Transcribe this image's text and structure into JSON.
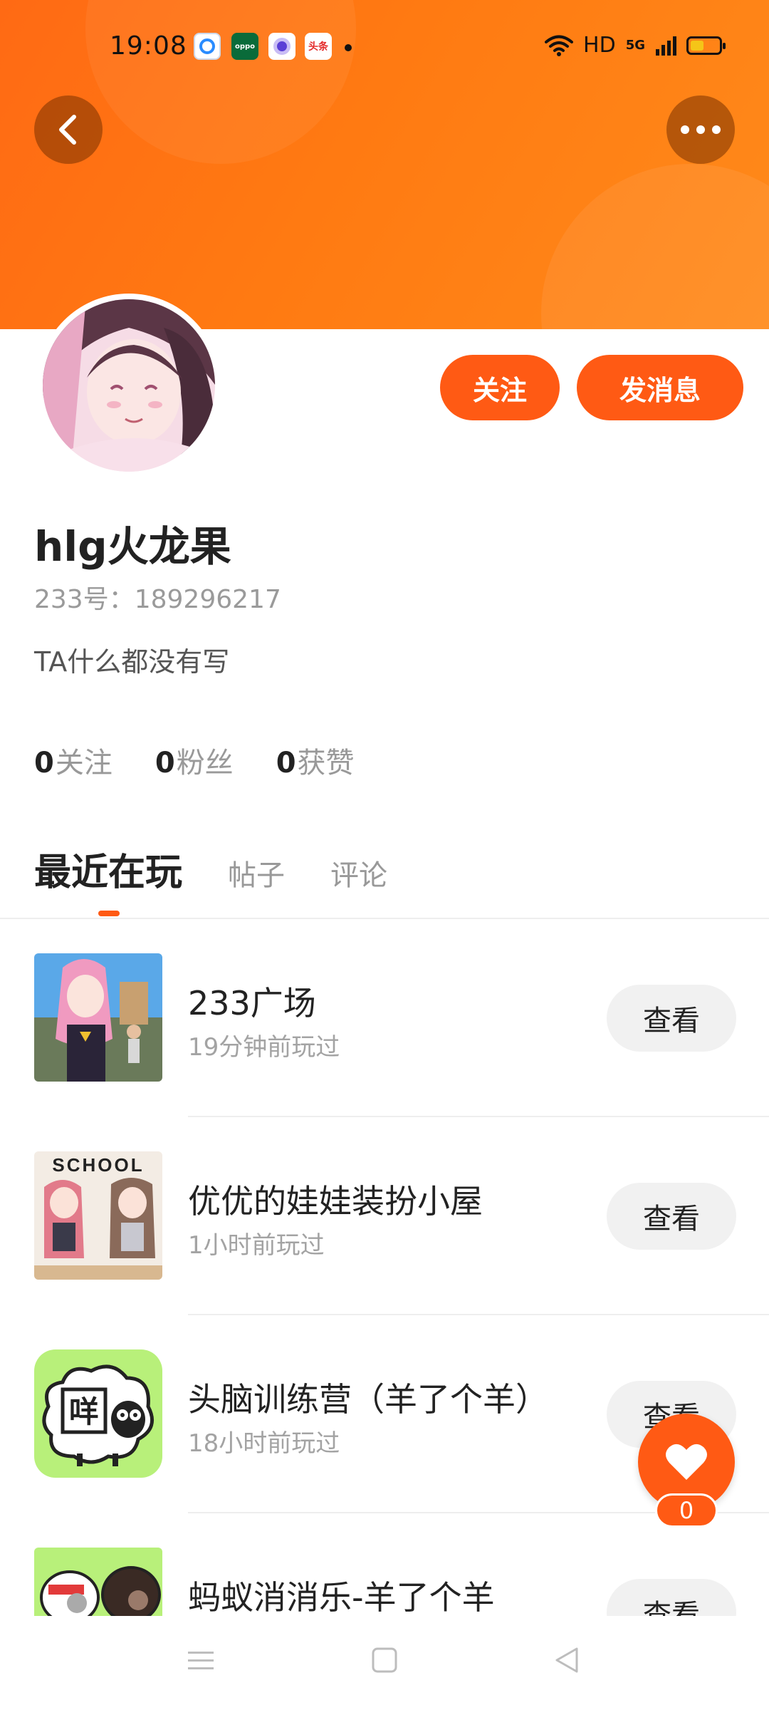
{
  "status_bar": {
    "time": "19:08",
    "notif_oppo": "oppo",
    "notif_toutiao": "头条",
    "network": "HD",
    "network_type": "5G"
  },
  "header": {
    "back_icon": "chevron-left-icon",
    "more_icon": "more-dots-icon"
  },
  "profile": {
    "follow_label": "关注",
    "message_label": "发消息",
    "username": "hlg火龙果",
    "user_id": "233号：189296217",
    "bio": "TA什么都没有写",
    "stats": [
      {
        "count": "0",
        "label": "关注"
      },
      {
        "count": "0",
        "label": "粉丝"
      },
      {
        "count": "0",
        "label": "获赞"
      }
    ]
  },
  "tabs": [
    {
      "label": "最近在玩",
      "active": true
    },
    {
      "label": "帖子",
      "active": false
    },
    {
      "label": "评论",
      "active": false
    }
  ],
  "games": [
    {
      "title": "233广场",
      "time": "19分钟前玩过",
      "button": "查看"
    },
    {
      "title": "优优的娃娃装扮小屋",
      "time": "1小时前玩过",
      "button": "查看",
      "thumb_text": "SCHOOL"
    },
    {
      "title": "头脑训练营（羊了个羊）",
      "time": "18小时前玩过",
      "button": "查看",
      "thumb_text": "咩"
    },
    {
      "title": "蚂蚁消消乐-羊了个羊",
      "time": "",
      "button": "查看"
    }
  ],
  "like": {
    "count": "0",
    "icon": "heart-icon"
  },
  "colors": {
    "accent": "#ff5a14",
    "banner": "#ff7a12"
  }
}
